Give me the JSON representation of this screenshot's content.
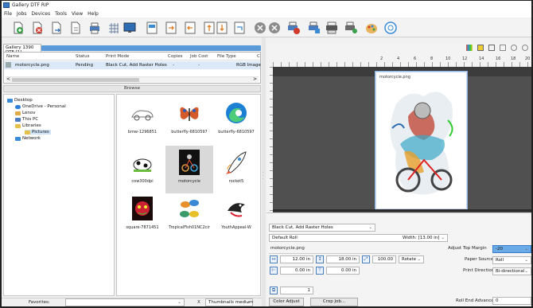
{
  "app": {
    "title": "Gallery DTF RIP"
  },
  "menu": [
    "File",
    "Jobs",
    "Devices",
    "Tools",
    "View",
    "Help"
  ],
  "queue": {
    "tab": "Gallery 1390 DTF [1]",
    "columns": [
      "Name",
      "Status",
      "Print Mode",
      "Copies",
      "Job Cost",
      "File Type",
      "C"
    ],
    "row": {
      "name": "motorcycle.png",
      "status": "Pending",
      "print_mode": "Black Cut, Add Raster Holes",
      "copies": "-",
      "job_cost": "-",
      "file_type": "RGB Image"
    }
  },
  "browse": {
    "label": "Browse"
  },
  "tree": [
    "Desktop",
    "OneDrive - Personal",
    "Lenov",
    "This PC",
    "Libraries",
    "Pictures",
    "Network"
  ],
  "thumbnails": [
    {
      "label": "bmw-1296851",
      "icon": "car-icon"
    },
    {
      "label": "butterfly-6810597",
      "icon": "butterfly-icon"
    },
    {
      "label": "butterfly-6810597",
      "icon": "edge-logo-icon"
    },
    {
      "label": "cow300dpi",
      "icon": "cow-icon"
    },
    {
      "label": "motorcycle",
      "icon": "motorcycle-icon"
    },
    {
      "label": "rocket5",
      "icon": "rocket-icon"
    },
    {
      "label": "square-7871451",
      "icon": "face-icon"
    },
    {
      "label": "TropicalFish01NC2cir",
      "icon": "fish-icon"
    },
    {
      "label": "YouthAppeal-W",
      "icon": "bird-icon"
    }
  ],
  "bottom": {
    "favorites": "Favorites:",
    "close": "X",
    "thumbnail_size": "Thumbnails medium"
  },
  "preview": {
    "ruler_numbers": [
      "2",
      "4",
      "6",
      "8",
      "10",
      "12",
      "14",
      "16",
      "18",
      "20"
    ],
    "media_label": "motorcycle.png"
  },
  "settings": {
    "print_mode": "Black Cut, Add Raster Holes",
    "media": "Default Roll",
    "width_label": "Width: [13.00 in]",
    "filename": "motorcycle.png",
    "width_value": "12.00 in",
    "height_value": "18.00 in",
    "scale_value": "100.00",
    "rotate_label": "Rotate",
    "x_offset": "0.00 in",
    "y_offset": "0.00 in",
    "copies": "1",
    "color_adjust": "Color Adjust",
    "crop_job": "Crop Job...",
    "adjust_top_margin_label": "Adjust Top Margin",
    "adjust_top_margin_value": "-20",
    "paper_source_label": "Paper Source",
    "paper_source_value": "Roll",
    "print_direction_label": "Print Direction",
    "print_direction_value": "Bi-directional",
    "roll_end_label": "Roll End Advance",
    "roll_end_value": "0"
  }
}
